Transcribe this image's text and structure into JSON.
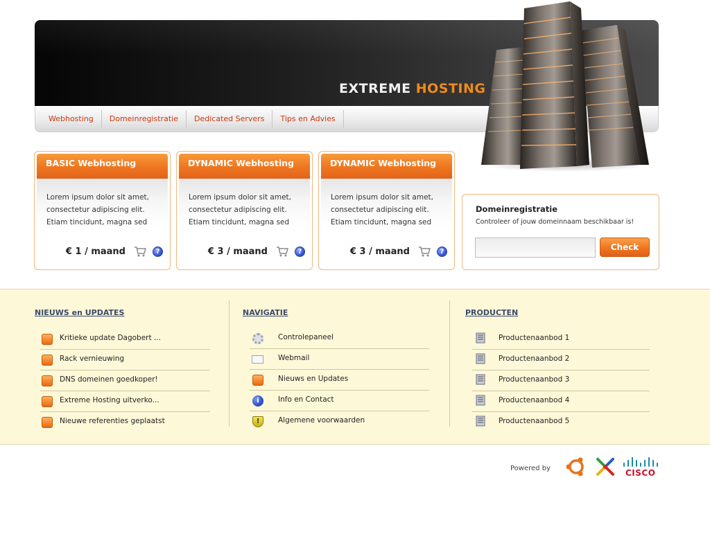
{
  "brand": {
    "part1": "EXTREME",
    "part2": "HOSTING",
    "color_white": "#f1f1f1",
    "color_orange": "#f08b1c"
  },
  "nav": {
    "items": [
      "Webhosting",
      "Domeinregistratie",
      "Dedicated Servers",
      "Tips en Advies"
    ]
  },
  "plans": [
    {
      "title": "BASIC Webhosting",
      "description": "Lorem ipsum dolor sit amet, consectetur adipiscing elit. Etiam tincidunt, magna sed",
      "price": "€ 1 / maand"
    },
    {
      "title": "DYNAMIC Webhosting",
      "description": "Lorem ipsum dolor sit amet, consectetur adipiscing elit. Etiam tincidunt, magna sed",
      "price": "€ 3 / maand"
    },
    {
      "title": "DYNAMIC Webhosting",
      "description": "Lorem ipsum dolor sit amet, consectetur adipiscing elit. Etiam tincidunt, magna sed",
      "price": "€ 3 / maand"
    }
  ],
  "domain": {
    "title": "Domeinregistratie",
    "subtitle": "Controleer of jouw domeinnaam beschikbaar is!",
    "input_value": "",
    "button": "Check"
  },
  "news": {
    "title": "NIEUWS en UPDATES",
    "items": [
      "Kritieke update Dagobert ...",
      "Rack vernieuwing",
      "DNS domeinen goedkoper!",
      "Extreme Hosting uitverko...",
      "Nieuwe referenties geplaatst"
    ]
  },
  "navigation": {
    "title": "NAVIGATIE",
    "items": [
      {
        "label": "Controlepaneel",
        "icon": "gear-icon"
      },
      {
        "label": "Webmail",
        "icon": "mail-icon"
      },
      {
        "label": "Nieuws en Updates",
        "icon": "rss-icon"
      },
      {
        "label": "Info en Contact",
        "icon": "info-icon"
      },
      {
        "label": "Algemene voorwaarden",
        "icon": "shield-icon"
      }
    ]
  },
  "products": {
    "title": "PRODUCTEN",
    "items": [
      "Productenaanbod 1",
      "Productenaanbod 2",
      "Productenaanbod 3",
      "Productenaanbod 4",
      "Productenaanbod 5"
    ]
  },
  "powered": {
    "label": "Powered by",
    "cisco": "CISCO"
  },
  "colors": {
    "accent": "#ee7620",
    "link": "#c9360e",
    "footer_bg": "#fdf8d8",
    "heading": "#3b4a68"
  }
}
